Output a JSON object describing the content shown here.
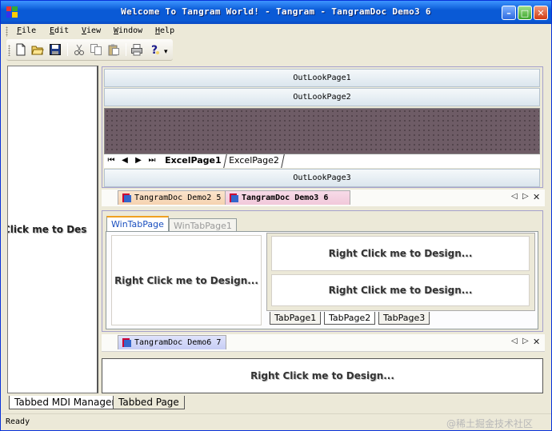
{
  "window": {
    "title": "Welcome To Tangram World! - Tangram - TangramDoc Demo3 6",
    "min_symbol": "–",
    "max_symbol": "□",
    "close_symbol": "✕"
  },
  "menu": {
    "items": [
      "File",
      "Edit",
      "View",
      "Window",
      "Help"
    ]
  },
  "toolbar": {
    "buttons": [
      "new-document",
      "open-folder",
      "save",
      "cut",
      "copy",
      "paste",
      "print",
      "help"
    ],
    "overflow_symbol": "▾"
  },
  "left_panel": {
    "text": "t Click me to Des"
  },
  "outlook": {
    "pages": [
      "OutLookPage1",
      "OutLookPage2",
      "OutLookPage3"
    ],
    "excel_tabs": [
      "ExcelPage1",
      "ExcelPage2"
    ],
    "nav_symbols": [
      "⏮",
      "◀",
      "▶",
      "⏭"
    ]
  },
  "doc_tabs_top": {
    "tabs": [
      "TangramDoc Demo2 5",
      "TangramDoc Demo3 6"
    ],
    "active_index": 1,
    "controls": [
      "◁",
      "▷",
      "✕"
    ]
  },
  "win_tabs": {
    "tabs": [
      "WinTabPage",
      "WinTabPage1"
    ],
    "active_index": 0
  },
  "design_panes": {
    "left": "Right Click me to Design...",
    "right_top": "Right Click me to Design...",
    "right_bottom": "Right Click me to Design..."
  },
  "inner_tabs": {
    "tabs": [
      "TabPage1",
      "TabPage2",
      "TabPage3"
    ],
    "active_index": 1
  },
  "doc_tabs_bottom": {
    "tabs": [
      "TangramDoc Demo6 7"
    ],
    "controls": [
      "◁",
      "▷",
      "✕"
    ]
  },
  "bottom_pane": {
    "text": "Right Click me to Design..."
  },
  "bottom_tabs": {
    "tabs": [
      "Tabbed MDI Manager",
      "Tabbed Page"
    ],
    "active_index": 0
  },
  "status": {
    "text": "Ready",
    "watermark": "@稀土掘金技术社区"
  },
  "colors": {
    "title_blue": "#0a5ad6",
    "grid_mauve": "#6e5c66",
    "outlook_bar": "#dbe6ee",
    "tab_orange": "#f5d3b0",
    "tab_pink": "#f1c8da",
    "tab_lavender": "#c7cdf5"
  }
}
